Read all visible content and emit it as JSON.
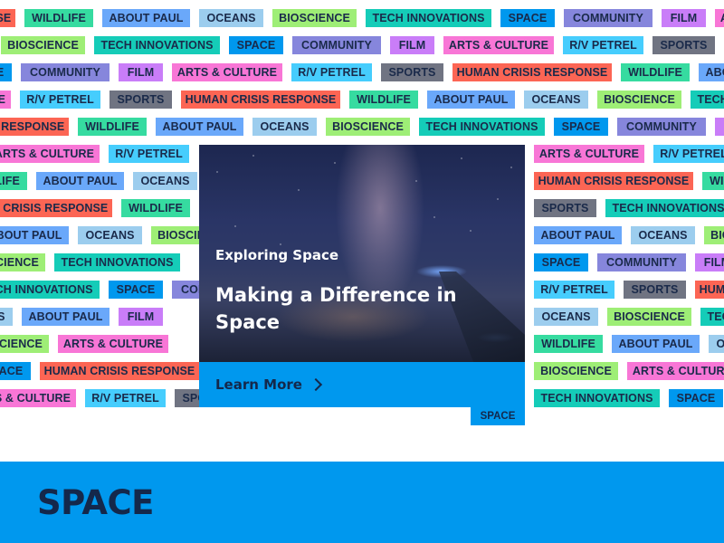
{
  "categories": {
    "HUMAN CRISIS RESPONSE": {
      "label": "HUMAN CRISIS RESPONSE",
      "color": "#fc6554"
    },
    "WILDLIFE": {
      "label": "WILDLIFE",
      "color": "#36dba0"
    },
    "ABOUT PAUL": {
      "label": "ABOUT PAUL",
      "color": "#6aa8fa"
    },
    "OCEANS": {
      "label": "OCEANS",
      "color": "#9ccdee"
    },
    "BIOSCIENCE": {
      "label": "BIOSCIENCE",
      "color": "#9eee76"
    },
    "TECH INNOVATIONS": {
      "label": "TECH INNOVATIONS",
      "color": "#15ccb8"
    },
    "SPACE": {
      "label": "SPACE",
      "color": "#0098ee"
    },
    "COMMUNITY": {
      "label": "COMMUNITY",
      "color": "#8686dc"
    },
    "FILM": {
      "label": "FILM",
      "color": "#c97df8"
    },
    "ARTS & CULTURE": {
      "label": "ARTS & CULTURE",
      "color": "#f876d6"
    },
    "R/V PETREL": {
      "label": "R/V PETREL",
      "color": "#46cdfd"
    },
    "SPORTS": {
      "label": "SPORTS",
      "color": "#707482"
    }
  },
  "tag_rows": [
    [
      "HUMAN CRISIS RESPONSE",
      "WILDLIFE",
      "ABOUT PAUL",
      "OCEANS",
      "BIOSCIENCE",
      "TECH INNOVATIONS",
      "SPACE",
      "COMMUNITY",
      "FILM",
      "ARTS & CULTURE"
    ],
    [
      "BIOSCIENCE",
      "TECH INNOVATIONS",
      "SPACE",
      "COMMUNITY",
      "FILM",
      "ARTS & CULTURE",
      "R/V PETREL",
      "SPORTS"
    ],
    [
      "SPACE",
      "COMMUNITY",
      "FILM",
      "ARTS & CULTURE",
      "R/V PETREL",
      "SPORTS",
      "HUMAN CRISIS RESPONSE",
      "WILDLIFE",
      "ABOUT PAUL"
    ],
    [
      "ARTS & CULTURE",
      "R/V PETREL",
      "SPORTS",
      "HUMAN CRISIS RESPONSE",
      "WILDLIFE",
      "ABOUT PAUL",
      "OCEANS",
      "BIOSCIENCE",
      "TECH INNOVATIONS"
    ],
    [
      "HUMAN CRISIS RESPONSE",
      "WILDLIFE",
      "ABOUT PAUL",
      "OCEANS",
      "BIOSCIENCE",
      "TECH INNOVATIONS",
      "SPACE",
      "COMMUNITY",
      "FILM"
    ],
    [
      "ARTS & CULTURE",
      "R/V PETREL",
      "ARTS & CULTURE",
      "R/V PETREL"
    ],
    [
      "WILDLIFE",
      "ABOUT PAUL",
      "OCEANS",
      "HUMAN CRISIS RESPONSE",
      "WILDLIFE"
    ],
    [
      "HUMAN CRISIS RESPONSE",
      "WILDLIFE",
      "SPORTS",
      "TECH INNOVATIONS"
    ],
    [
      "ABOUT PAUL",
      "OCEANS",
      "BIOSCIENCE",
      "ABOUT PAUL",
      "OCEANS",
      "BIOSCIENCE"
    ],
    [
      "BIOSCIENCE",
      "TECH INNOVATIONS",
      "SPACE",
      "COMMUNITY",
      "FILM"
    ],
    [
      "TECH INNOVATIONS",
      "SPACE",
      "COMMUNITY",
      "R/V PETREL",
      "SPORTS",
      "HUMAN CRISIS RESPONSE"
    ],
    [
      "OCEANS",
      "ABOUT PAUL",
      "FILM",
      "OCEANS",
      "BIOSCIENCE",
      "TECH INNOVATIONS"
    ],
    [
      "BIOSCIENCE",
      "ARTS & CULTURE",
      "WILDLIFE",
      "ABOUT PAUL",
      "OCEANS"
    ],
    [
      "SPACE",
      "HUMAN CRISIS RESPONSE",
      "BIOSCIENCE",
      "ARTS & CULTURE"
    ],
    [
      "ARTS & CULTURE",
      "R/V PETREL",
      "SPORTS",
      "TECH INNOVATIONS",
      "SPACE"
    ]
  ],
  "card": {
    "eyebrow": "Exploring Space",
    "title": "Making a Difference in Space",
    "cta_label": "Learn More",
    "cta_icon": "chevron-right-icon",
    "badge": "SPACE",
    "image_alt": "Milky Way over airplane wing at night"
  },
  "footer": {
    "title": "SPACE"
  },
  "colors": {
    "accent": "#0098ee",
    "text_dark": "#14284b",
    "background": "#ffffff"
  }
}
